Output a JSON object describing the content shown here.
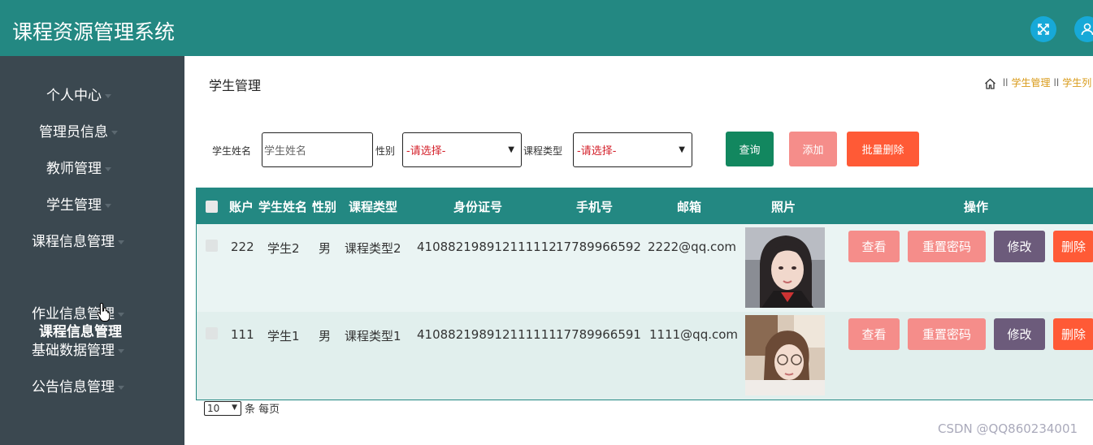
{
  "app": {
    "title": "课程资源管理系统"
  },
  "topbar": {
    "icons": [
      "fullscreen-icon",
      "user-icon"
    ],
    "accent": "#238882",
    "icon_bg": "#17a9d8"
  },
  "sidebar": {
    "items": [
      {
        "label": "个人中心"
      },
      {
        "label": "管理员信息"
      },
      {
        "label": "教师管理"
      },
      {
        "label": "学生管理"
      },
      {
        "label": "课程信息管理"
      },
      {
        "label": "作业信息管理"
      },
      {
        "label": "基础数据管理"
      },
      {
        "label": "公告信息管理"
      }
    ],
    "sub_item": "课程信息管理"
  },
  "page": {
    "title": "学生管理",
    "breadcrumb": {
      "sep1": "ll",
      "crumb1": "学生管理",
      "sep2": "ll",
      "crumb2": "学生列"
    }
  },
  "search": {
    "name_label": "学生姓名",
    "name_placeholder": "学生姓名",
    "gender_label": "性别",
    "gender_value": "-请选择-",
    "course_type_label": "课程类型",
    "course_type_value": "-请选择-",
    "query_button": "查询",
    "add_button": "添加",
    "batch_delete_button": "批量删除"
  },
  "table": {
    "columns": [
      "账户",
      "学生姓名",
      "性别",
      "课程类型",
      "身份证号",
      "手机号",
      "邮箱",
      "照片",
      "操作"
    ],
    "rows": [
      {
        "account": "222",
        "name": "学生2",
        "gender": "男",
        "course_type": "课程类型2",
        "id_card": "410882198912111112",
        "phone": "17789966592",
        "email": "2222@qq.com"
      },
      {
        "account": "111",
        "name": "学生1",
        "gender": "男",
        "course_type": "课程类型1",
        "id_card": "410882198912111111",
        "phone": "17789966591",
        "email": "1111@qq.com"
      }
    ],
    "actions": {
      "view": "查看",
      "reset_password": "重置密码",
      "edit": "修改",
      "delete": "删除"
    }
  },
  "pager": {
    "page_size": "10",
    "suffix": "条 每页"
  },
  "watermark": "CSDN @QQ860234001"
}
